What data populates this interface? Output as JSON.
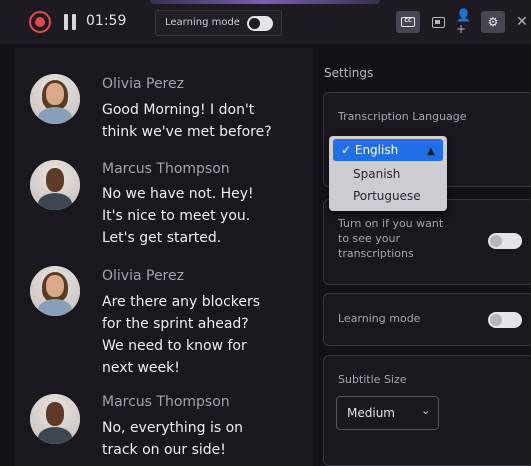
{
  "toolbar": {
    "timer": "01:59",
    "learning_mode_label": "Learning mode",
    "icons": [
      "record-icon",
      "pause-icon",
      "captions-icon",
      "window-icon",
      "add-user-icon",
      "settings-icon",
      "close-icon"
    ],
    "close_glyph": "✕",
    "add_user_glyph": "👤+",
    "settings_glyph": "⚙"
  },
  "chat": {
    "messages": [
      {
        "name": "Olivia Perez",
        "text_lines": [
          "Good Morning!  I don't",
          "think we've met before?"
        ],
        "avatar": "olivia-avatar"
      },
      {
        "name": "Marcus Thompson",
        "text_lines": [
          "No we have not. Hey!",
          "It's nice to meet you.",
          "Let's get started."
        ],
        "avatar": "marcus-avatar"
      },
      {
        "name": "Olivia Perez",
        "text_lines": [
          "Are there any blockers",
          "for the sprint ahead?",
          "We need to know for",
          "next week!"
        ],
        "avatar": "olivia-avatar"
      },
      {
        "name": "Marcus Thompson",
        "text_lines": [
          "No, everything is on",
          "track on our side!"
        ],
        "avatar": "marcus-avatar"
      }
    ]
  },
  "settings": {
    "title": "Settings",
    "transcription": {
      "label": "Transcription Language",
      "options": [
        "English",
        "Spanish",
        "Portuguese"
      ],
      "selected": "✓ English"
    },
    "transcription_toggle": {
      "text_lines": [
        "Turn on if you want",
        "to see your",
        "transcriptions"
      ]
    },
    "learning_mode": {
      "label": "Learning mode"
    },
    "subtitle_size": {
      "label": "Subtitle Size",
      "value": "Medium",
      "chevron": "⌄"
    }
  },
  "colors": {
    "background": "#151119",
    "record_red": "#e5484d",
    "selected_blue": "#1f6fe6"
  }
}
